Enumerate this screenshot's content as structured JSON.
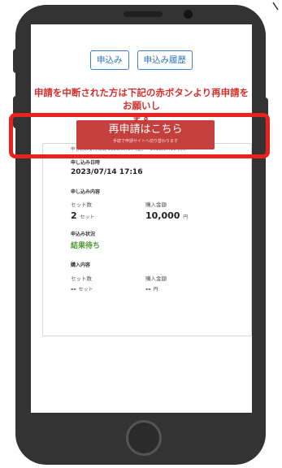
{
  "tabs": [
    {
      "label": "申込み"
    },
    {
      "label": "申込み履歴"
    }
  ],
  "notice": {
    "line1": "申請を中断された方は下記の赤ボタンより再申請をお願いし",
    "line2": "ます"
  },
  "redo_button": {
    "label": "再申請はこちら",
    "sub_label": "手続で申請サイトへ切り替わります"
  },
  "card": {
    "period": "申し込み受付期間 2023/07/07 (金) ～ 2023/07/19 (水)",
    "date": {
      "label": "申し込み日時",
      "value": "2023/07/14 17:16"
    },
    "content1": {
      "label": "申し込み内容",
      "sets_label": "セット数",
      "sets_value": "2",
      "sets_unit": "セット",
      "amount_label": "購入金額",
      "amount_value": "10,000",
      "amount_unit": "円"
    },
    "status": {
      "label": "申込み状況",
      "value": "結果待ち"
    },
    "content2": {
      "label": "購入内容",
      "sets_label": "セット数",
      "sets_value": "--",
      "sets_unit": "セット",
      "amount_label": "購入金額",
      "amount_value": "--",
      "amount_unit": "円"
    }
  },
  "colors": {
    "accent_blue": "#3d7fd1",
    "notice_red": "#d2312e",
    "button_red": "#c4403d",
    "highlight_red": "#e8221c",
    "status_green": "#4a9a2a",
    "phone_body": "#333333"
  }
}
